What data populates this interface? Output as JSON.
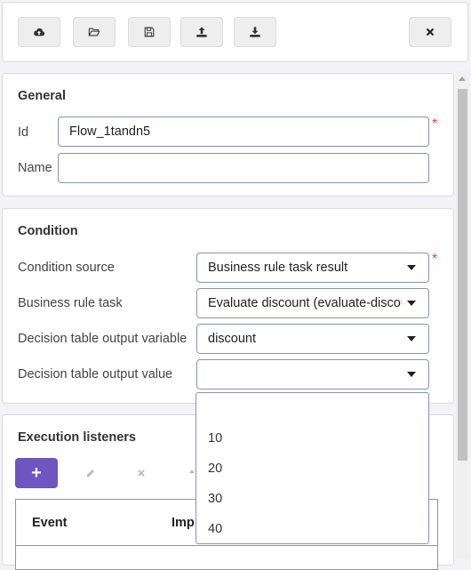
{
  "toolbar": {
    "buttons": [
      {
        "name": "upload-cloud-icon"
      },
      {
        "name": "open-folder-icon"
      },
      {
        "name": "save-icon"
      },
      {
        "name": "export-icon"
      },
      {
        "name": "import-icon"
      },
      {
        "name": "close-icon"
      }
    ]
  },
  "general": {
    "title": "General",
    "id_label": "Id",
    "id_value": "Flow_1tandn5",
    "name_label": "Name",
    "name_value": ""
  },
  "condition": {
    "title": "Condition",
    "source_label": "Condition source",
    "source_value": "Business rule task result",
    "task_label": "Business rule task",
    "task_value": "Evaluate discount (evaluate-discount)",
    "output_var_label": "Decision table output variable",
    "output_var_value": "discount",
    "output_val_label": "Decision table output value",
    "output_val_value": ""
  },
  "listeners": {
    "title": "Execution listeners",
    "add_label": "+",
    "columns": [
      "Event",
      "Imp"
    ]
  },
  "dropdown": {
    "options": [
      "",
      "10",
      "20",
      "30",
      "40"
    ]
  },
  "required_marker": "*",
  "colors": {
    "accent": "#6d55c2",
    "required": "#e04545",
    "border": "#8c91b8"
  }
}
